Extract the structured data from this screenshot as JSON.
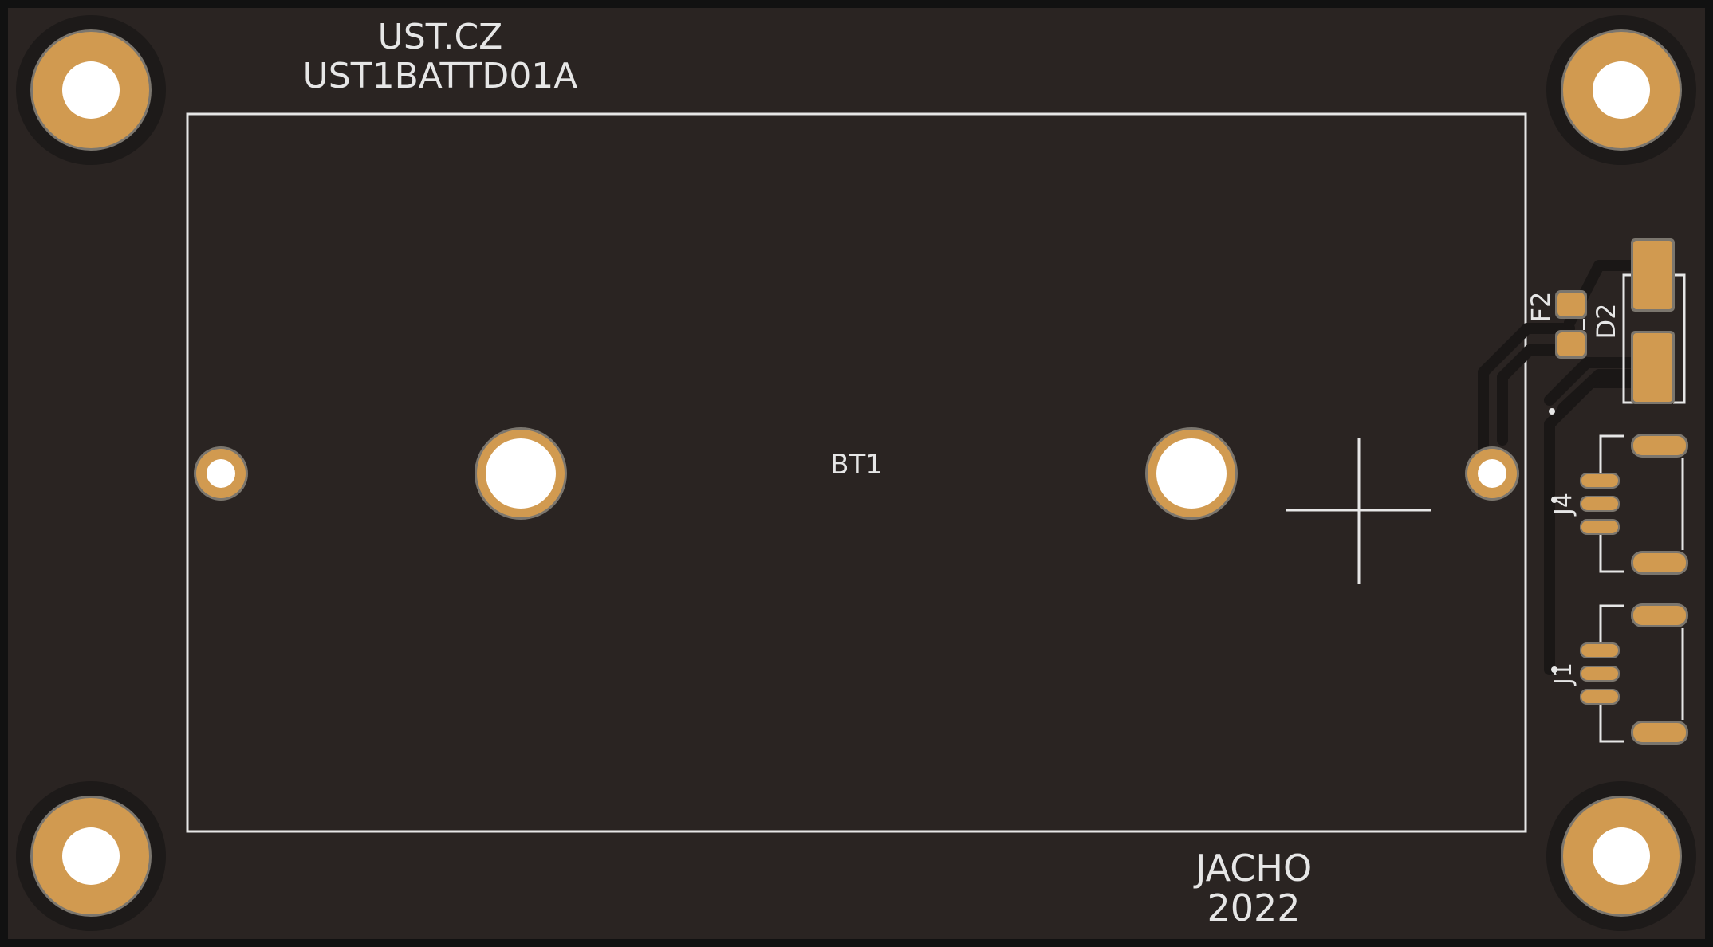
{
  "colors": {
    "board": "#2a2422",
    "edge": "#111111",
    "copper": "#d19a50",
    "pad_ring": "#7b766e",
    "silkscreen": "#e6e6e6",
    "hole": "#ffffff",
    "keepout": "#1d1a19",
    "trace": "#1a1716"
  },
  "silkscreen": {
    "company": "UST.CZ",
    "part_number": "UST1BATTD01A",
    "author": "JACHO",
    "year": "2022"
  },
  "refs": {
    "battery": "BT1",
    "fuse": "F2",
    "diode": "D2",
    "conn_top": "J4",
    "conn_bottom": "J1"
  }
}
